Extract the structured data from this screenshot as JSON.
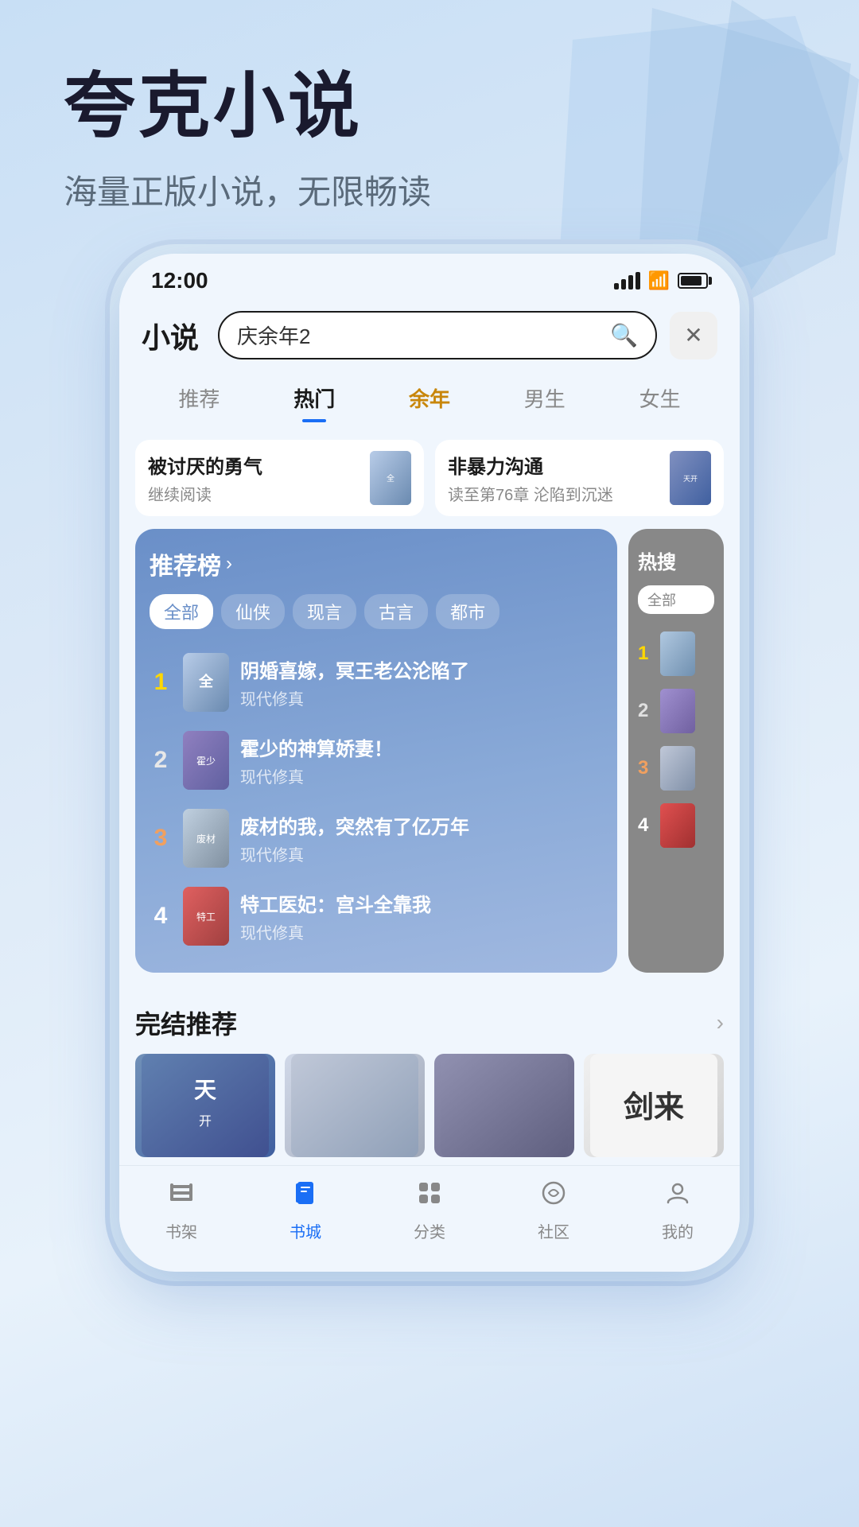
{
  "app": {
    "name": "夸克小说",
    "promo_title": "夸克小说",
    "promo_subtitle": "海量正版小说，无限畅读"
  },
  "status_bar": {
    "time": "12:00"
  },
  "header": {
    "title": "小说",
    "search_placeholder": "庆余年2",
    "search_value": "庆余年2"
  },
  "nav_tabs": [
    {
      "label": "推荐",
      "active": false,
      "special": false
    },
    {
      "label": "热门",
      "active": true,
      "special": false
    },
    {
      "label": "余年",
      "active": false,
      "special": true
    },
    {
      "label": "男生",
      "active": false,
      "special": false
    },
    {
      "label": "女生",
      "active": false,
      "special": false
    }
  ],
  "recent_reads": [
    {
      "title": "被讨厌的勇气",
      "progress": "继续阅读"
    },
    {
      "title": "非暴力沟通",
      "progress": "读至第76章 沦陷到沉迷"
    }
  ],
  "recommend_section": {
    "title": "推荐榜",
    "arrow": "›",
    "filters": [
      "全部",
      "仙侠",
      "现言",
      "古言",
      "都市"
    ],
    "active_filter": "全部",
    "books": [
      {
        "rank": 1,
        "title": "阴婚喜嫁，冥王老公沦陷了",
        "genre": "现代修真"
      },
      {
        "rank": 2,
        "title": "霍少的神算娇妻！",
        "genre": "现代修真"
      },
      {
        "rank": 3,
        "title": "废材的我，突然有了亿万年",
        "genre": "现代修真"
      },
      {
        "rank": 4,
        "title": "特工医妃：宫斗全靠我",
        "genre": "现代修真"
      }
    ]
  },
  "hot_search_section": {
    "title": "热搜",
    "filter": "全部"
  },
  "complete_section": {
    "title": "完结推荐",
    "arrow": "›"
  },
  "bottom_nav": [
    {
      "label": "书架",
      "icon": "shelf",
      "active": false
    },
    {
      "label": "书城",
      "icon": "book",
      "active": true
    },
    {
      "label": "分类",
      "icon": "grid",
      "active": false
    },
    {
      "label": "社区",
      "icon": "community",
      "active": false
    },
    {
      "label": "我的",
      "icon": "profile",
      "active": false
    }
  ]
}
